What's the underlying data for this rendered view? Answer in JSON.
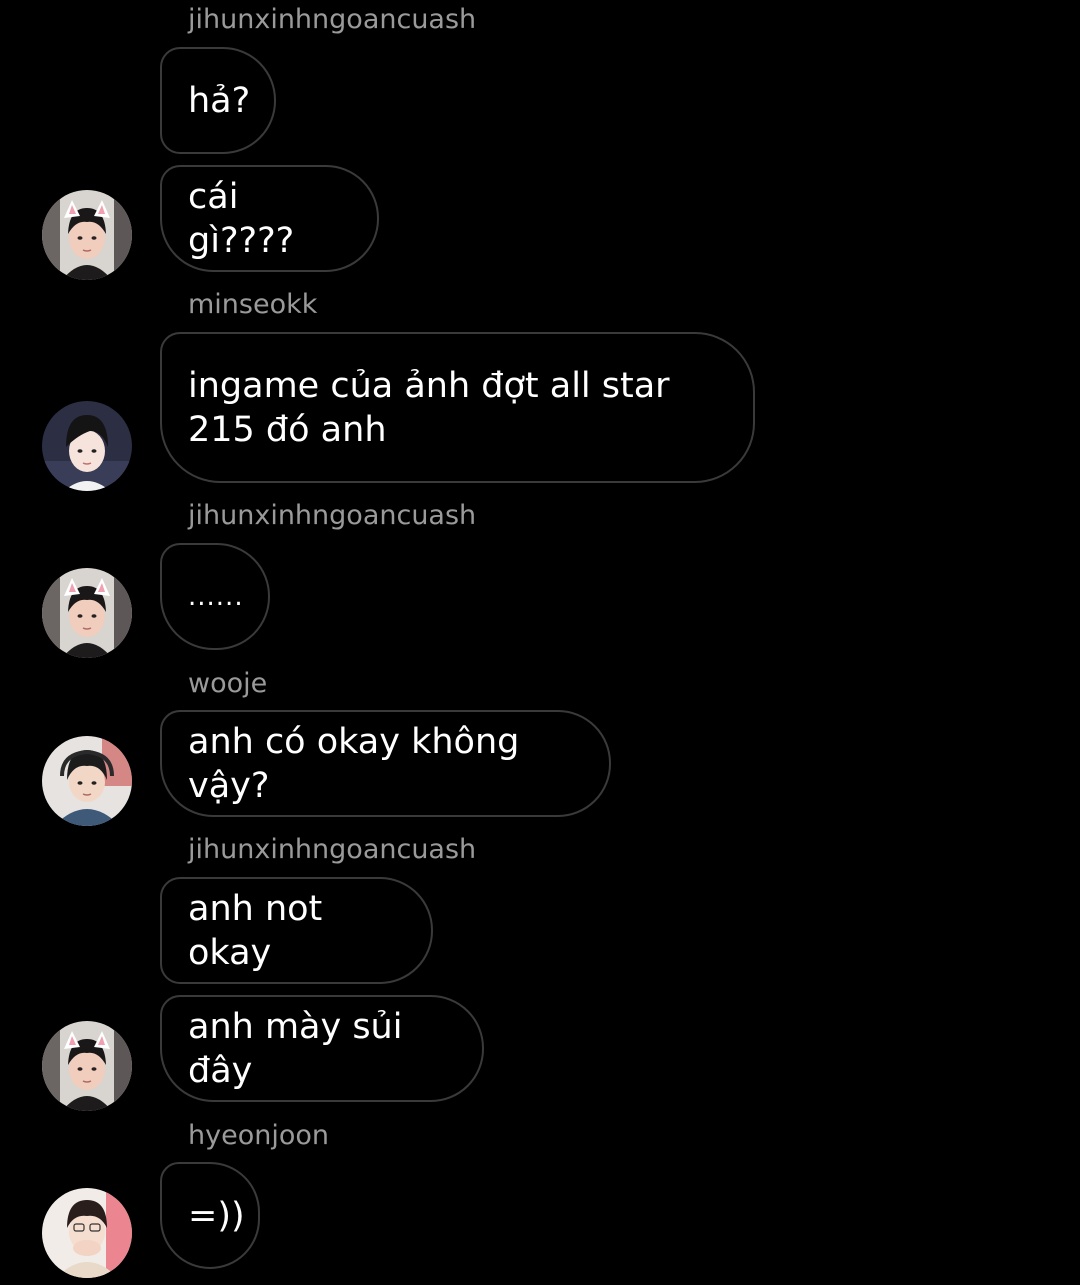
{
  "colors": {
    "background": "#000000",
    "bubble_border": "#3a3a3a",
    "message_text": "#ffffff",
    "sender_text": "#9a9a9a"
  },
  "chat": {
    "senders": [
      "jihunxinhngoancuash",
      "minseokk",
      "jihunxinhngoancuash",
      "wooje",
      "jihunxinhngoancuash",
      "hyeonjoon"
    ],
    "messages": [
      "hả?",
      "cái gì????",
      "ingame của ảnh đợt all star 215 đó anh",
      "......",
      "anh có okay không vậy?",
      "anh not okay",
      "anh mày sủi đây",
      "=))"
    ],
    "avatars": [
      "avatar-jihunxinhngoancuash",
      "avatar-minseokk",
      "avatar-jihunxinhngoancuash",
      "avatar-wooje",
      "avatar-jihunxinhngoancuash",
      "avatar-hyeonjoon"
    ]
  }
}
